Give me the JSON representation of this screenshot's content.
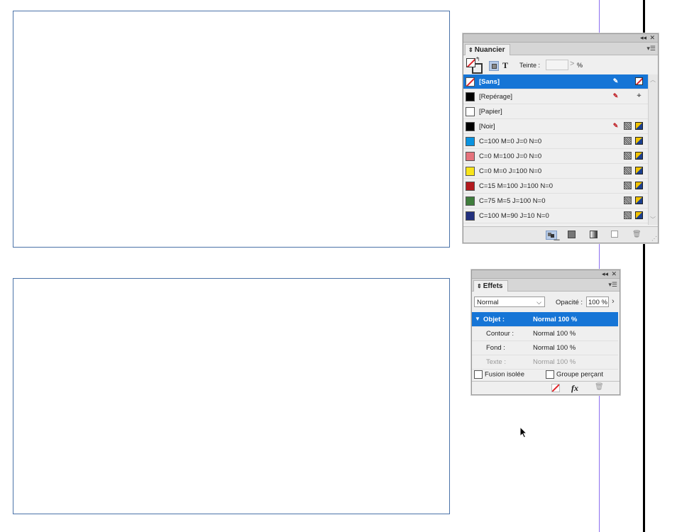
{
  "nuancier": {
    "title": "Nuancier",
    "tint_label": "Teinte :",
    "tint_value": "",
    "tint_unit": "%",
    "swatches": [
      {
        "name": "[Sans]",
        "color": "none",
        "selected": true
      },
      {
        "name": "[Repérage]",
        "color": "#000000"
      },
      {
        "name": "[Papier]",
        "color": "#ffffff"
      },
      {
        "name": "[Noir]",
        "color": "#000000"
      },
      {
        "name": "C=100 M=0 J=0 N=0",
        "color": "#0a93e0"
      },
      {
        "name": "C=0 M=100 J=0 N=0",
        "color": "#e5727c"
      },
      {
        "name": "C=0 M=0 J=100 N=0",
        "color": "#f8e41a"
      },
      {
        "name": "C=15 M=100 J=100 N=0",
        "color": "#b31a1e"
      },
      {
        "name": "C=75 M=5 J=100 N=0",
        "color": "#3f7d3c"
      },
      {
        "name": "C=100 M=90 J=10 N=0",
        "color": "#22307e"
      }
    ]
  },
  "effets": {
    "title": "Effets",
    "blend_mode": "Normal",
    "opacity_label": "Opacité :",
    "opacity_value": "100 %",
    "rows": [
      {
        "label": "Objet :",
        "value": "Normal 100 %"
      },
      {
        "label": "Contour :",
        "value": "Normal 100 %"
      },
      {
        "label": "Fond :",
        "value": "Normal 100 %"
      },
      {
        "label": "Texte :",
        "value": "Normal 100 %"
      }
    ],
    "isolate_label": "Fusion isolée",
    "knockout_label": "Groupe perçant",
    "fx_label": "fx"
  }
}
